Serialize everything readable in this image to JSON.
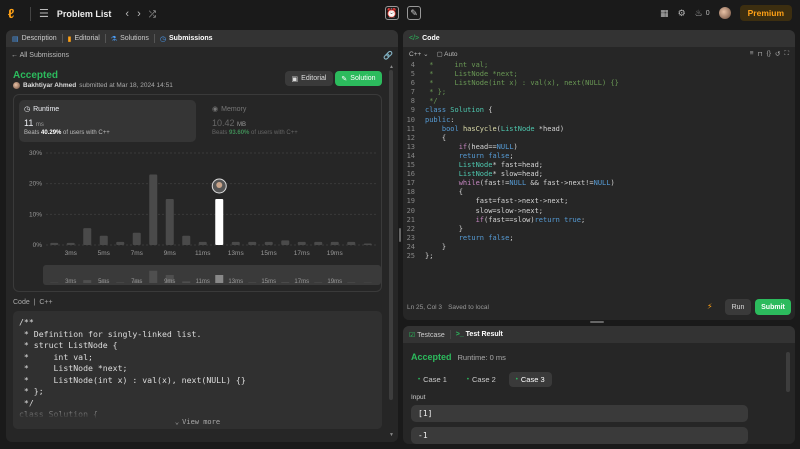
{
  "topbar": {
    "title": "Problem List",
    "coins": "0",
    "premium": "Premium"
  },
  "left": {
    "tabs": [
      {
        "label": "Description"
      },
      {
        "label": "Editorial"
      },
      {
        "label": "Solutions"
      },
      {
        "label": "Submissions"
      }
    ],
    "back_label": "All Submissions",
    "status": "Accepted",
    "author": "Bakhtiyar Ahmed",
    "submitted_text": "submitted at Mar 18, 2024 14:51",
    "editorial_btn": "Editorial",
    "solution_btn": "Solution",
    "runtime": {
      "label": "Runtime",
      "value": "11",
      "unit": "ms",
      "beats_prefix": "Beats",
      "beats_pct": "40.29%",
      "beats_suffix": "of users with C++"
    },
    "memory": {
      "label": "Memory",
      "value": "10.42",
      "unit": "MB",
      "beats_prefix": "Beats",
      "beats_pct": "93.60%",
      "beats_suffix": "of users with C++"
    },
    "code_header": {
      "code": "Code",
      "lang": "C++"
    },
    "code_lines": [
      "/**",
      " * Definition for singly-linked list.",
      " * struct ListNode {",
      " *     int val;",
      " *     ListNode *next;",
      " *     ListNode(int x) : val(x), next(NULL) {}",
      " * };",
      " */",
      "class Solution {"
    ],
    "view_more": "View more"
  },
  "chart_data": {
    "type": "bar",
    "ylim": [
      0,
      30
    ],
    "yticks": [
      "30%",
      "20%",
      "10%",
      "0%"
    ],
    "xticks": [
      "3ms",
      "5ms",
      "7ms",
      "9ms",
      "11ms",
      "13ms",
      "15ms",
      "17ms",
      "19ms"
    ],
    "values": [
      0.7,
      0.7,
      5.5,
      3,
      1,
      4,
      23,
      15,
      3,
      1,
      15,
      1,
      1,
      1,
      1.5,
      1,
      1,
      1,
      1,
      0.5
    ],
    "highlight_index": 10,
    "highlight_color": "#ffffff",
    "bar_color": "#4a4a4a",
    "mini_xticks": [
      "3ms",
      "5ms",
      "7ms",
      "9ms",
      "11ms",
      "13ms",
      "15ms",
      "17ms",
      "19ms"
    ]
  },
  "editor": {
    "tab": "Code",
    "lang": "C++",
    "mode": "Auto",
    "status_pos": "Ln 25, Col 3",
    "status_saved": "Saved to local",
    "run": "Run",
    "submit": "Submit",
    "lines": [
      {
        "n": "4",
        "t": " *     int val;"
      },
      {
        "n": "5",
        "t": " *     ListNode *next;"
      },
      {
        "n": "6",
        "t": " *     ListNode(int x) : val(x), next(NULL) {}"
      },
      {
        "n": "7",
        "t": " * };"
      },
      {
        "n": "8",
        "t": " */"
      },
      {
        "n": "9",
        "t": "class Solution {"
      },
      {
        "n": "10",
        "t": "public:"
      },
      {
        "n": "11",
        "t": "    bool hasCycle(ListNode *head)"
      },
      {
        "n": "12",
        "t": "    {"
      },
      {
        "n": "13",
        "t": "        if(head==NULL)"
      },
      {
        "n": "14",
        "t": "        return false;"
      },
      {
        "n": "15",
        "t": "        ListNode* fast=head;"
      },
      {
        "n": "16",
        "t": "        ListNode* slow=head;"
      },
      {
        "n": "17",
        "t": "        while(fast!=NULL && fast->next!=NULL)"
      },
      {
        "n": "18",
        "t": "        {"
      },
      {
        "n": "19",
        "t": "            fast=fast->next->next;"
      },
      {
        "n": "20",
        "t": "            slow=slow->next;"
      },
      {
        "n": "21",
        "t": "            if(fast==slow)return true;"
      },
      {
        "n": "22",
        "t": "        }"
      },
      {
        "n": "23",
        "t": "        return false;"
      },
      {
        "n": "24",
        "t": "    }"
      },
      {
        "n": "25",
        "t": "};"
      }
    ]
  },
  "result": {
    "tab_testcase": "Testcase",
    "tab_result": "Test Result",
    "status": "Accepted",
    "runtime": "Runtime: 0 ms",
    "cases": [
      "Case 1",
      "Case 2",
      "Case 3"
    ],
    "active_case": 2,
    "input_label": "Input",
    "input_value": "[1]",
    "input_value2": "-1"
  }
}
